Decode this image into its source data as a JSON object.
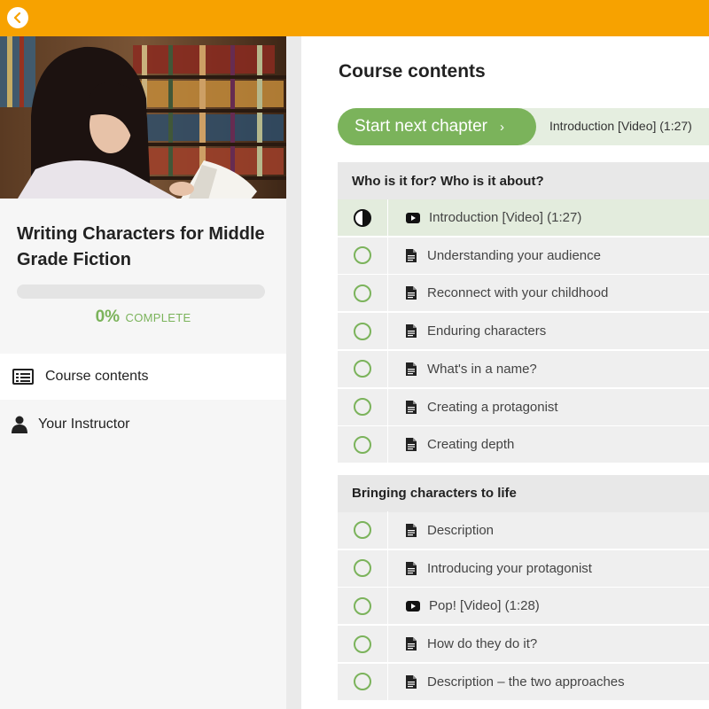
{
  "colors": {
    "accent": "#f7a200",
    "success": "#7bb35b",
    "current_row": "#e3ecdd"
  },
  "header": {
    "back_icon": "chevron-left-icon"
  },
  "sidebar": {
    "course_title": "Writing Characters for Middle Grade Fiction",
    "progress": {
      "percent_value": 0,
      "percent": "0%",
      "label": "COMPLETE"
    },
    "nav": [
      {
        "label": "Course contents",
        "icon": "list-icon",
        "active": true
      },
      {
        "label": "Your Instructor",
        "icon": "user-icon",
        "active": false
      }
    ]
  },
  "main": {
    "title": "Course contents",
    "start_button": {
      "label": "Start next chapter",
      "chevron": "›"
    },
    "next_chapter": "Introduction [Video] (1:27)",
    "sections": [
      {
        "title": "Who is it for? Who is it about?",
        "lessons": [
          {
            "label": "Introduction [Video] (1:27)",
            "type": "video",
            "status": "in-progress"
          },
          {
            "label": "Understanding your audience",
            "type": "text",
            "status": "not-started"
          },
          {
            "label": "Reconnect with your childhood",
            "type": "text",
            "status": "not-started"
          },
          {
            "label": "Enduring characters",
            "type": "text",
            "status": "not-started"
          },
          {
            "label": "What's in a name?",
            "type": "text",
            "status": "not-started"
          },
          {
            "label": "Creating a protagonist",
            "type": "text",
            "status": "not-started"
          },
          {
            "label": "Creating depth",
            "type": "text",
            "status": "not-started"
          }
        ]
      },
      {
        "title": "Bringing characters to life",
        "lessons": [
          {
            "label": "Description",
            "type": "text",
            "status": "not-started"
          },
          {
            "label": "Introducing your protagonist",
            "type": "text",
            "status": "not-started"
          },
          {
            "label": "Pop! [Video] (1:28)",
            "type": "video",
            "status": "not-started"
          },
          {
            "label": "How do they do it?",
            "type": "text",
            "status": "not-started"
          },
          {
            "label": "Description – the two approaches",
            "type": "text",
            "status": "not-started"
          }
        ]
      }
    ]
  }
}
